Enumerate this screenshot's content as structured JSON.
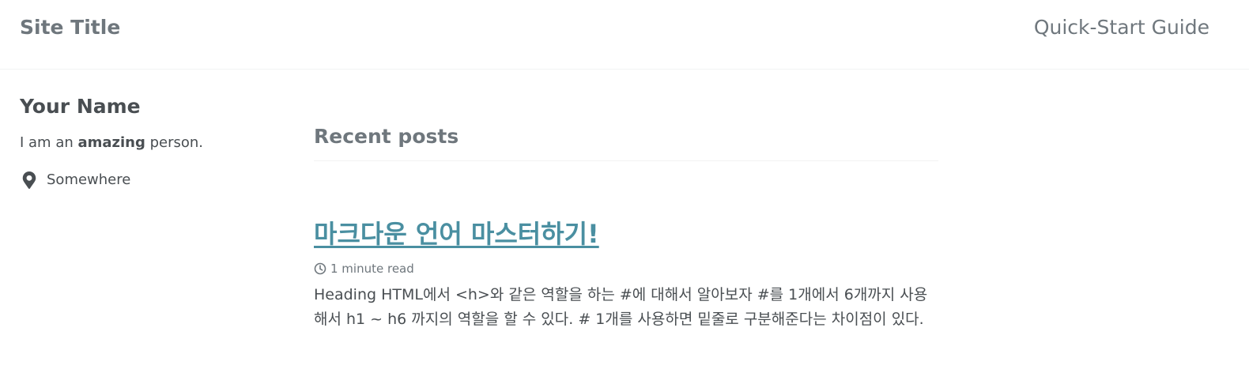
{
  "masthead": {
    "site_title": "Site Title",
    "nav": [
      {
        "label": "Quick-Start Guide"
      }
    ]
  },
  "author": {
    "name": "Your Name",
    "bio_prefix": "I am an ",
    "bio_bold": "amazing",
    "bio_suffix": " person.",
    "location": "Somewhere",
    "location_icon": "map-marker-icon"
  },
  "main": {
    "section_title": "Recent posts",
    "posts": [
      {
        "title": "마크다운 언어 마스터하기!",
        "read_time": "1 minute read",
        "read_time_icon": "clock-icon",
        "excerpt": "Heading HTML에서 <h>와 같은 역할을 하는 #에 대해서 알아보자 #를 1개에서 6개까지 사용해서 h1 ~ h6 까지의 역할을 할 수 있다. # 1개를 사용하면 밑줄로 구분해준다는 차이점이 있다."
      }
    ]
  },
  "colors": {
    "link": "#4a8fa1",
    "text": "#494e52",
    "muted": "#6f777d"
  }
}
